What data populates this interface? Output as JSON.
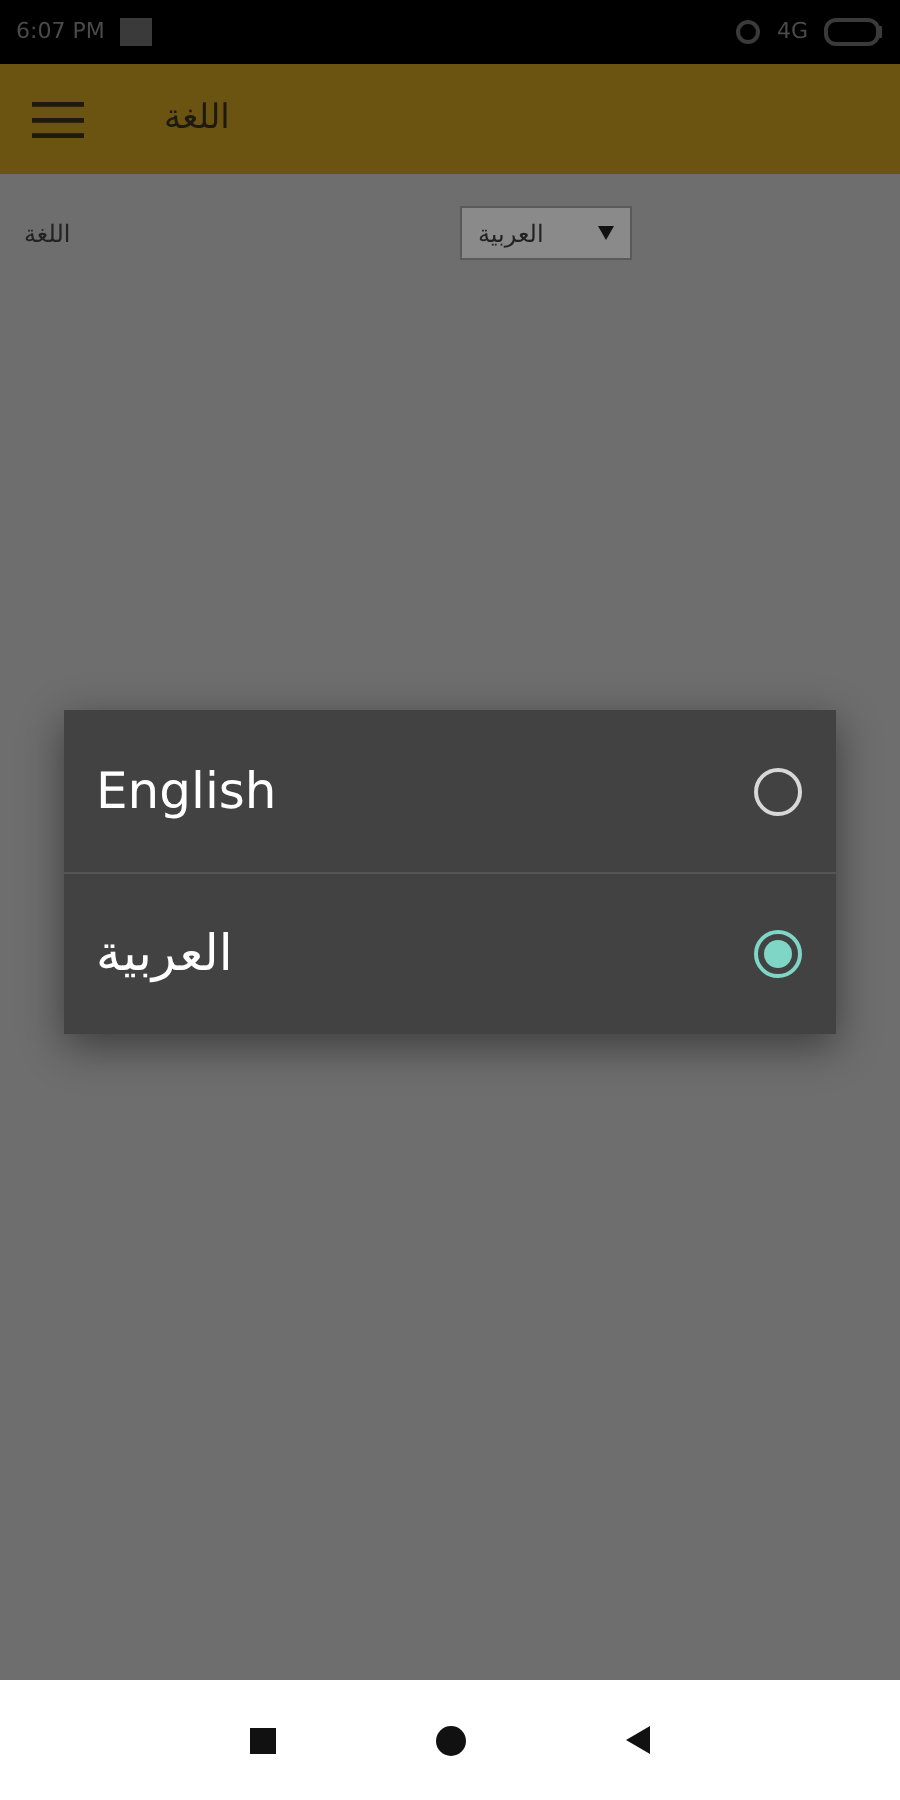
{
  "status_bar": {
    "time": "6:07 PM",
    "network": "4G"
  },
  "app_bar": {
    "title": "اللغة"
  },
  "settings": [
    {
      "label": "اللغة",
      "value": "العربية"
    }
  ],
  "dialog": {
    "options": [
      {
        "label": "English",
        "selected": false
      },
      {
        "label": "العربية",
        "selected": true
      }
    ]
  }
}
